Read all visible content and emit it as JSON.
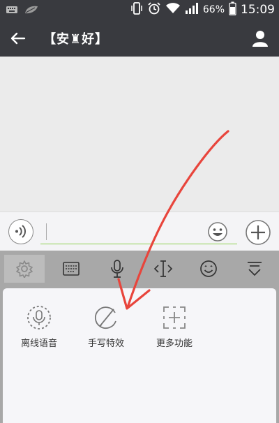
{
  "status_bar": {
    "battery": "66%",
    "time": "15:09",
    "icons": [
      "keyboard-icon",
      "leaf-icon",
      "vibrate-icon",
      "alarm-icon",
      "wifi-icon",
      "signal-icon",
      "battery-icon"
    ]
  },
  "header": {
    "title": "【安♜好】",
    "back_icon": "back-arrow-icon",
    "profile_icon": "person-icon"
  },
  "input_bar": {
    "voice_icon": "voice-icon",
    "input_value": "",
    "emoji_icon": "smiley-icon",
    "plus_icon": "plus-icon",
    "accent_color": "#8fd14f"
  },
  "keyboard_toolbar": {
    "tools": [
      "settings-icon",
      "keyboard-icon",
      "microphone-icon",
      "cursor-icon",
      "emoji-icon",
      "collapse-icon"
    ],
    "active_index": 0
  },
  "features": {
    "items": [
      {
        "label": "离线语音",
        "icon": "offline-voice-icon"
      },
      {
        "label": "手写特效",
        "icon": "handwriting-icon"
      },
      {
        "label": "更多功能",
        "icon": "more-functions-icon"
      }
    ]
  },
  "annotation": {
    "color": "#e8453c",
    "kind": "arrow pointing to 手写特效"
  }
}
